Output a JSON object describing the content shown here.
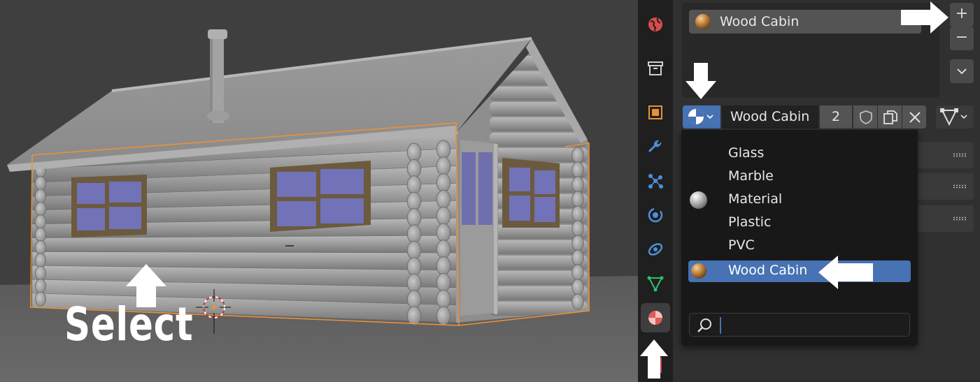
{
  "viewport": {
    "caption": "Select"
  },
  "tabs": [
    {
      "name": "world-tab",
      "icon": "world-icon"
    },
    {
      "name": "collection-tab",
      "icon": "collection-box-icon"
    },
    {
      "name": "object-tab",
      "icon": "object-icon"
    },
    {
      "name": "modifier-tab",
      "icon": "wrench-icon"
    },
    {
      "name": "particles-tab",
      "icon": "particles-icon"
    },
    {
      "name": "physics-tab",
      "icon": "physics-icon"
    },
    {
      "name": "constraints-tab",
      "icon": "constraints-icon"
    },
    {
      "name": "data-tab",
      "icon": "mesh-data-icon"
    },
    {
      "name": "material-tab",
      "icon": "material-icon",
      "active": true
    }
  ],
  "material_slots": {
    "items": [
      {
        "label": "Wood Cabin"
      }
    ],
    "add_label": "+",
    "remove_label": "−"
  },
  "datablock": {
    "name": "Wood Cabin",
    "users": "2"
  },
  "browse_menu": {
    "items": [
      {
        "label": "Glass",
        "preview": "none"
      },
      {
        "label": "Marble",
        "preview": "none"
      },
      {
        "label": "Material",
        "preview": "grey-sphere"
      },
      {
        "label": "Plastic",
        "preview": "none"
      },
      {
        "label": "PVC",
        "preview": "none"
      },
      {
        "label": "Wood Cabin",
        "preview": "wood-sphere",
        "selected": true
      }
    ],
    "search_value": ""
  },
  "colors": {
    "accent": "#4772b3",
    "selection_outline": "#e8913a",
    "window_glass": "#7272b8",
    "window_frame": "#6b5a3e",
    "annotation_arrow": "#ffffff"
  }
}
